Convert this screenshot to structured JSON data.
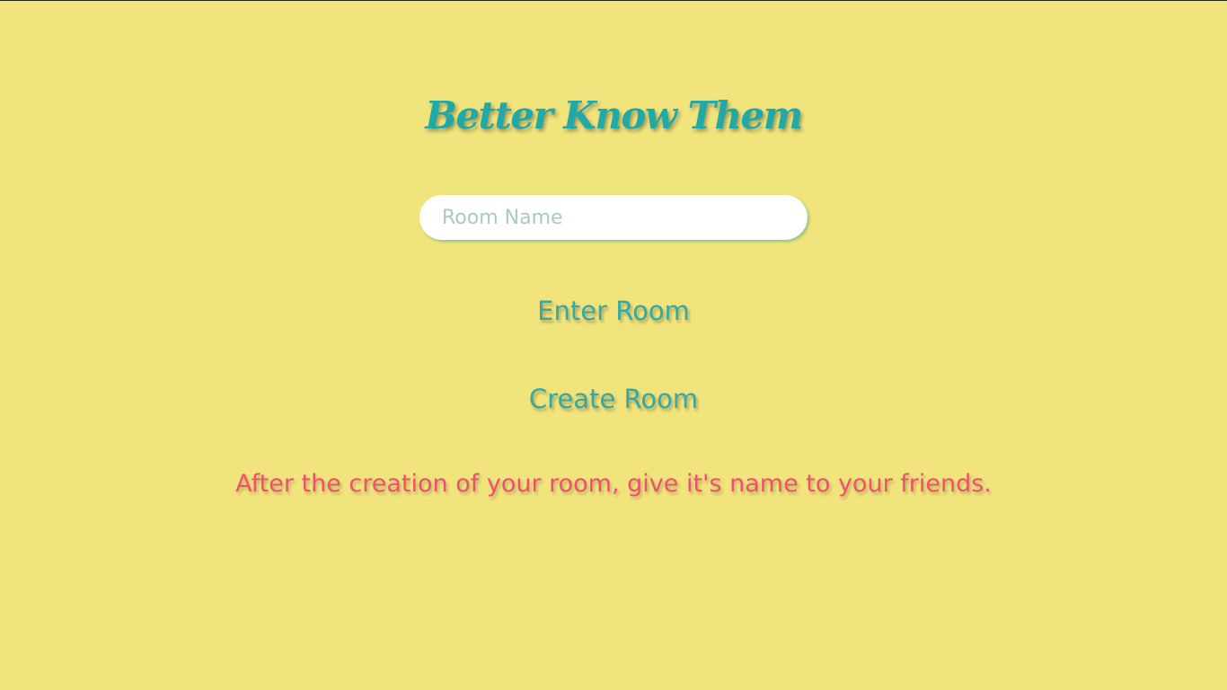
{
  "app": {
    "title": "Better Know Them"
  },
  "form": {
    "room_name_placeholder": "Room Name",
    "room_name_value": "",
    "enter_label": "Enter Room",
    "create_label": "Create Room"
  },
  "info": {
    "hint": "After the creation of your room, give it's name to your friends."
  },
  "colors": {
    "background": "#f2e47c",
    "accent": "#35a9a3",
    "warning": "#f0506e"
  }
}
